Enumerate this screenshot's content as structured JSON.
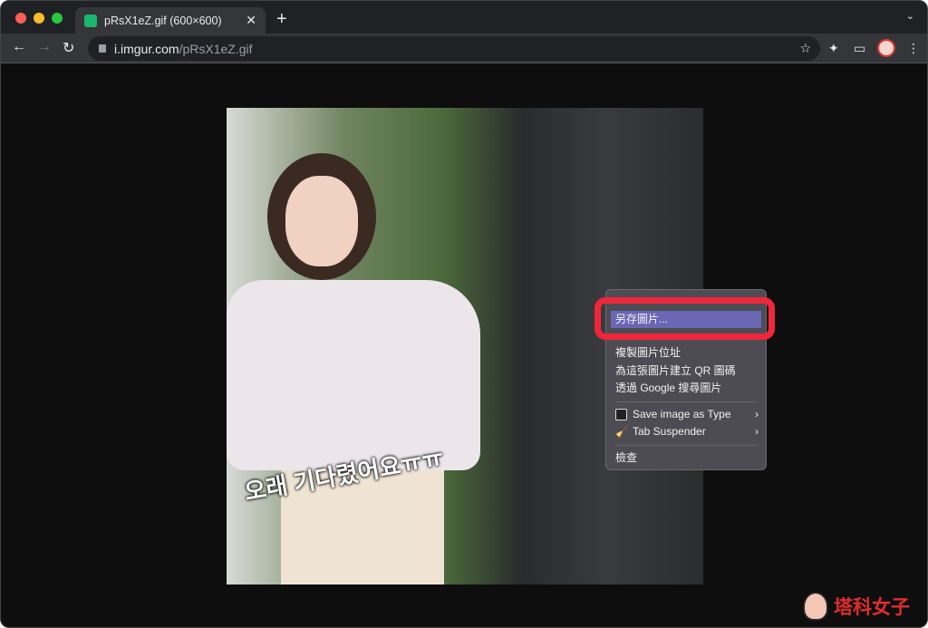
{
  "tab": {
    "title": "pRsX1eZ.gif (600×600)",
    "close": "✕",
    "new_tab": "+",
    "tab_search": "⌄"
  },
  "toolbar": {
    "back": "←",
    "forward": "→",
    "reload": "↻",
    "url_host": "i.imgur.com",
    "url_path": "/pRsX1eZ.gif",
    "bookmark": "☆",
    "extensions": "✦",
    "cast": "▭",
    "menu": "⋮"
  },
  "image": {
    "caption": "오래 기다렸어요ㅠㅠ"
  },
  "context_menu": {
    "items": [
      {
        "label": "另存圖片...",
        "highlighted": true
      },
      {
        "label": "複製圖片位址"
      },
      {
        "label": "為這張圖片建立 QR 圖碼"
      },
      {
        "label": "透過 Google 搜尋圖片"
      },
      {
        "label": "Save image as Type",
        "submenu": true
      },
      {
        "label": "Tab Suspender",
        "submenu": true
      },
      {
        "label": "檢查"
      }
    ],
    "chevron": "›"
  },
  "colors": {
    "highlight": "#6b67b5",
    "annotation": "#f0263a"
  },
  "watermark": {
    "text": "塔科女子"
  }
}
